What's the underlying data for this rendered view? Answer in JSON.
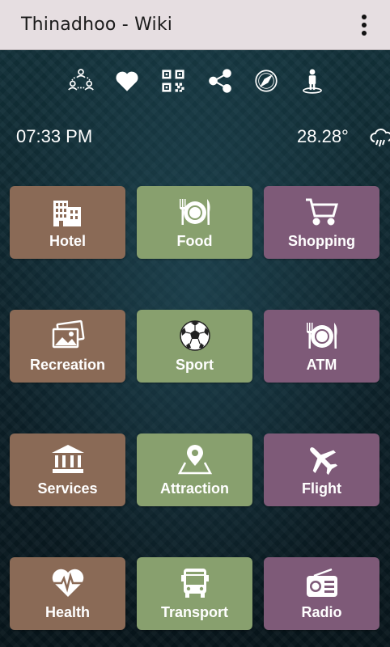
{
  "app_bar": {
    "title": "Thinadhoo - Wiki"
  },
  "toolbar": {
    "icons": [
      "people-network-icon",
      "heart-icon",
      "qr-code-icon",
      "share-icon",
      "compass-icon",
      "person-location-icon"
    ]
  },
  "status": {
    "time": "07:33 PM",
    "temperature": "28.28°",
    "weather_icon": "rain-cloud-icon"
  },
  "colors": {
    "brown": "#8a6a56",
    "green": "#88a06e",
    "purple": "#7e5a78",
    "app_bar": "#e6dee1"
  },
  "tiles": [
    {
      "label": "Hotel",
      "icon": "building-icon",
      "color": "brown"
    },
    {
      "label": "Food",
      "icon": "plate-cutlery-icon",
      "color": "green"
    },
    {
      "label": "Shopping",
      "icon": "cart-icon",
      "color": "purple"
    },
    {
      "label": "Recreation",
      "icon": "pictures-icon",
      "color": "brown"
    },
    {
      "label": "Sport",
      "icon": "soccer-ball-icon",
      "color": "green"
    },
    {
      "label": "ATM",
      "icon": "plate-cutlery-icon",
      "color": "purple"
    },
    {
      "label": "Services",
      "icon": "bank-icon",
      "color": "brown"
    },
    {
      "label": "Attraction",
      "icon": "map-pin-icon",
      "color": "green"
    },
    {
      "label": "Flight",
      "icon": "airplane-icon",
      "color": "purple"
    },
    {
      "label": "Health",
      "icon": "heart-pulse-icon",
      "color": "brown"
    },
    {
      "label": "Transport",
      "icon": "bus-icon",
      "color": "green"
    },
    {
      "label": "Radio",
      "icon": "radio-icon",
      "color": "purple"
    }
  ]
}
